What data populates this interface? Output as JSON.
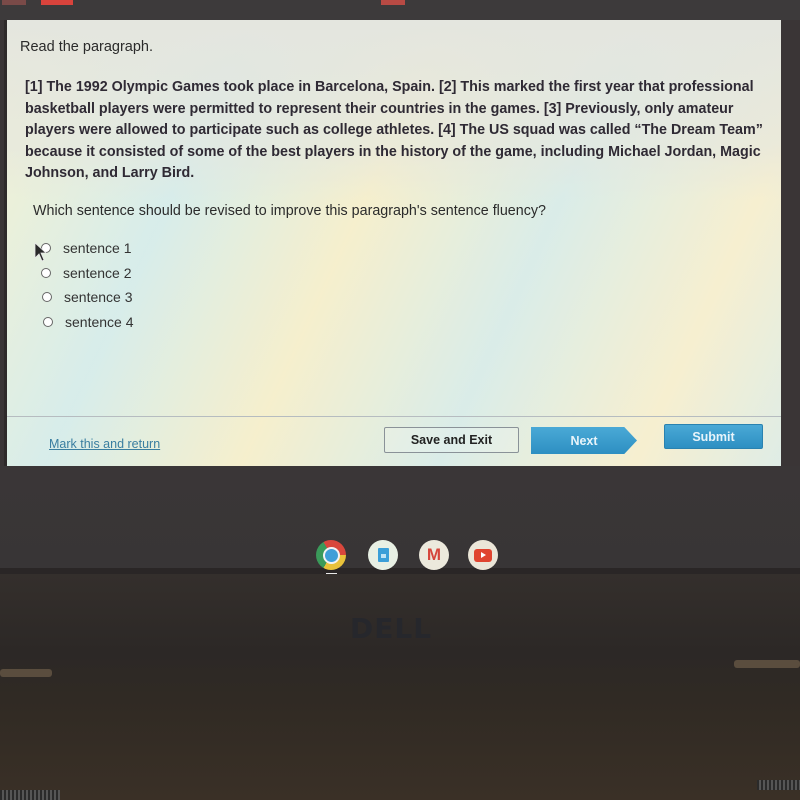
{
  "quiz": {
    "instructions": "Read the paragraph.",
    "passage": "[1] The 1992 Olympic Games took place in Barcelona, Spain. [2] This marked the first year that professional basketball players were permitted to represent their countries in the games. [3] Previously, only amateur players were allowed to participate such as college athletes.  [4] The US squad was called “The Dream Team” because it consisted of some of the best players in the history of the game, including Michael Jordan, Magic Johnson, and Larry Bird.",
    "question": "Which sentence should be revised to improve this paragraph's sentence fluency?",
    "options": [
      {
        "label": "sentence 1",
        "selected": false
      },
      {
        "label": "sentence 2",
        "selected": false
      },
      {
        "label": "sentence 3",
        "selected": false
      },
      {
        "label": "sentence 4",
        "selected": false
      }
    ]
  },
  "footer": {
    "mark_link": "Mark this and return",
    "save_exit": "Save and Exit",
    "next": "Next",
    "submit": "Submit"
  },
  "shelf": {
    "apps": [
      {
        "name": "Chrome",
        "icon": "chrome-icon",
        "running": true
      },
      {
        "name": "Docs",
        "icon": "docs-icon",
        "running": false
      },
      {
        "name": "Gmail",
        "icon": "gmail-icon",
        "glyph": "M",
        "running": false
      },
      {
        "name": "YouTube",
        "icon": "youtube-icon",
        "running": false
      }
    ]
  },
  "device": {
    "brand": "DELL"
  },
  "colors": {
    "accent": "#2d8fc2",
    "link": "#3a7ea0"
  }
}
